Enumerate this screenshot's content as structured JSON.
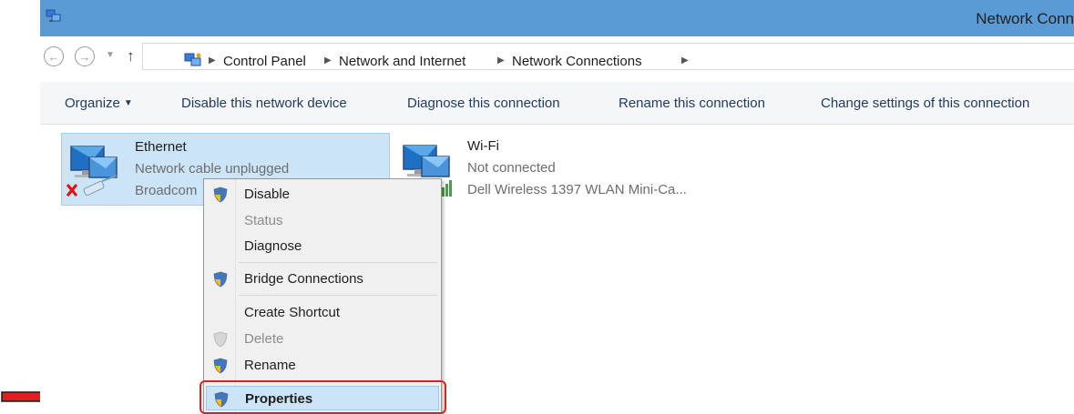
{
  "window": {
    "title": "Network Conn"
  },
  "address": {
    "breadcrumbs": [
      "Control Panel",
      "Network and Internet",
      "Network Connections"
    ]
  },
  "toolbar": {
    "organize": "Organize",
    "disable": "Disable this network device",
    "diagnose": "Diagnose this connection",
    "rename": "Rename this connection",
    "change": "Change settings of this connection"
  },
  "connections": [
    {
      "name": "Ethernet",
      "status": "Network cable unplugged",
      "device": "Broadcom",
      "selected": true,
      "icon": "ethernet-disconnected-icon"
    },
    {
      "name": "Wi-Fi",
      "status": "Not connected",
      "device": "Dell Wireless 1397 WLAN Mini-Ca...",
      "selected": false,
      "icon": "wifi-adapter-icon"
    }
  ],
  "context_menu": {
    "items": [
      {
        "label": "Disable",
        "shield": true,
        "disabled": false
      },
      {
        "label": "Status",
        "shield": false,
        "disabled": true
      },
      {
        "label": "Diagnose",
        "shield": false,
        "disabled": false
      },
      {
        "label": "Bridge Connections",
        "shield": true,
        "disabled": false
      },
      {
        "label": "Create Shortcut",
        "shield": false,
        "disabled": false
      },
      {
        "label": "Delete",
        "shield": true,
        "disabled": true
      },
      {
        "label": "Rename",
        "shield": true,
        "disabled": false
      },
      {
        "label": "Properties",
        "shield": true,
        "disabled": false,
        "bold": true,
        "highlighted": true
      }
    ]
  },
  "colors": {
    "titlebar": "#5b9bd5",
    "selection": "#cce4f7",
    "annotation": "#e02020"
  }
}
